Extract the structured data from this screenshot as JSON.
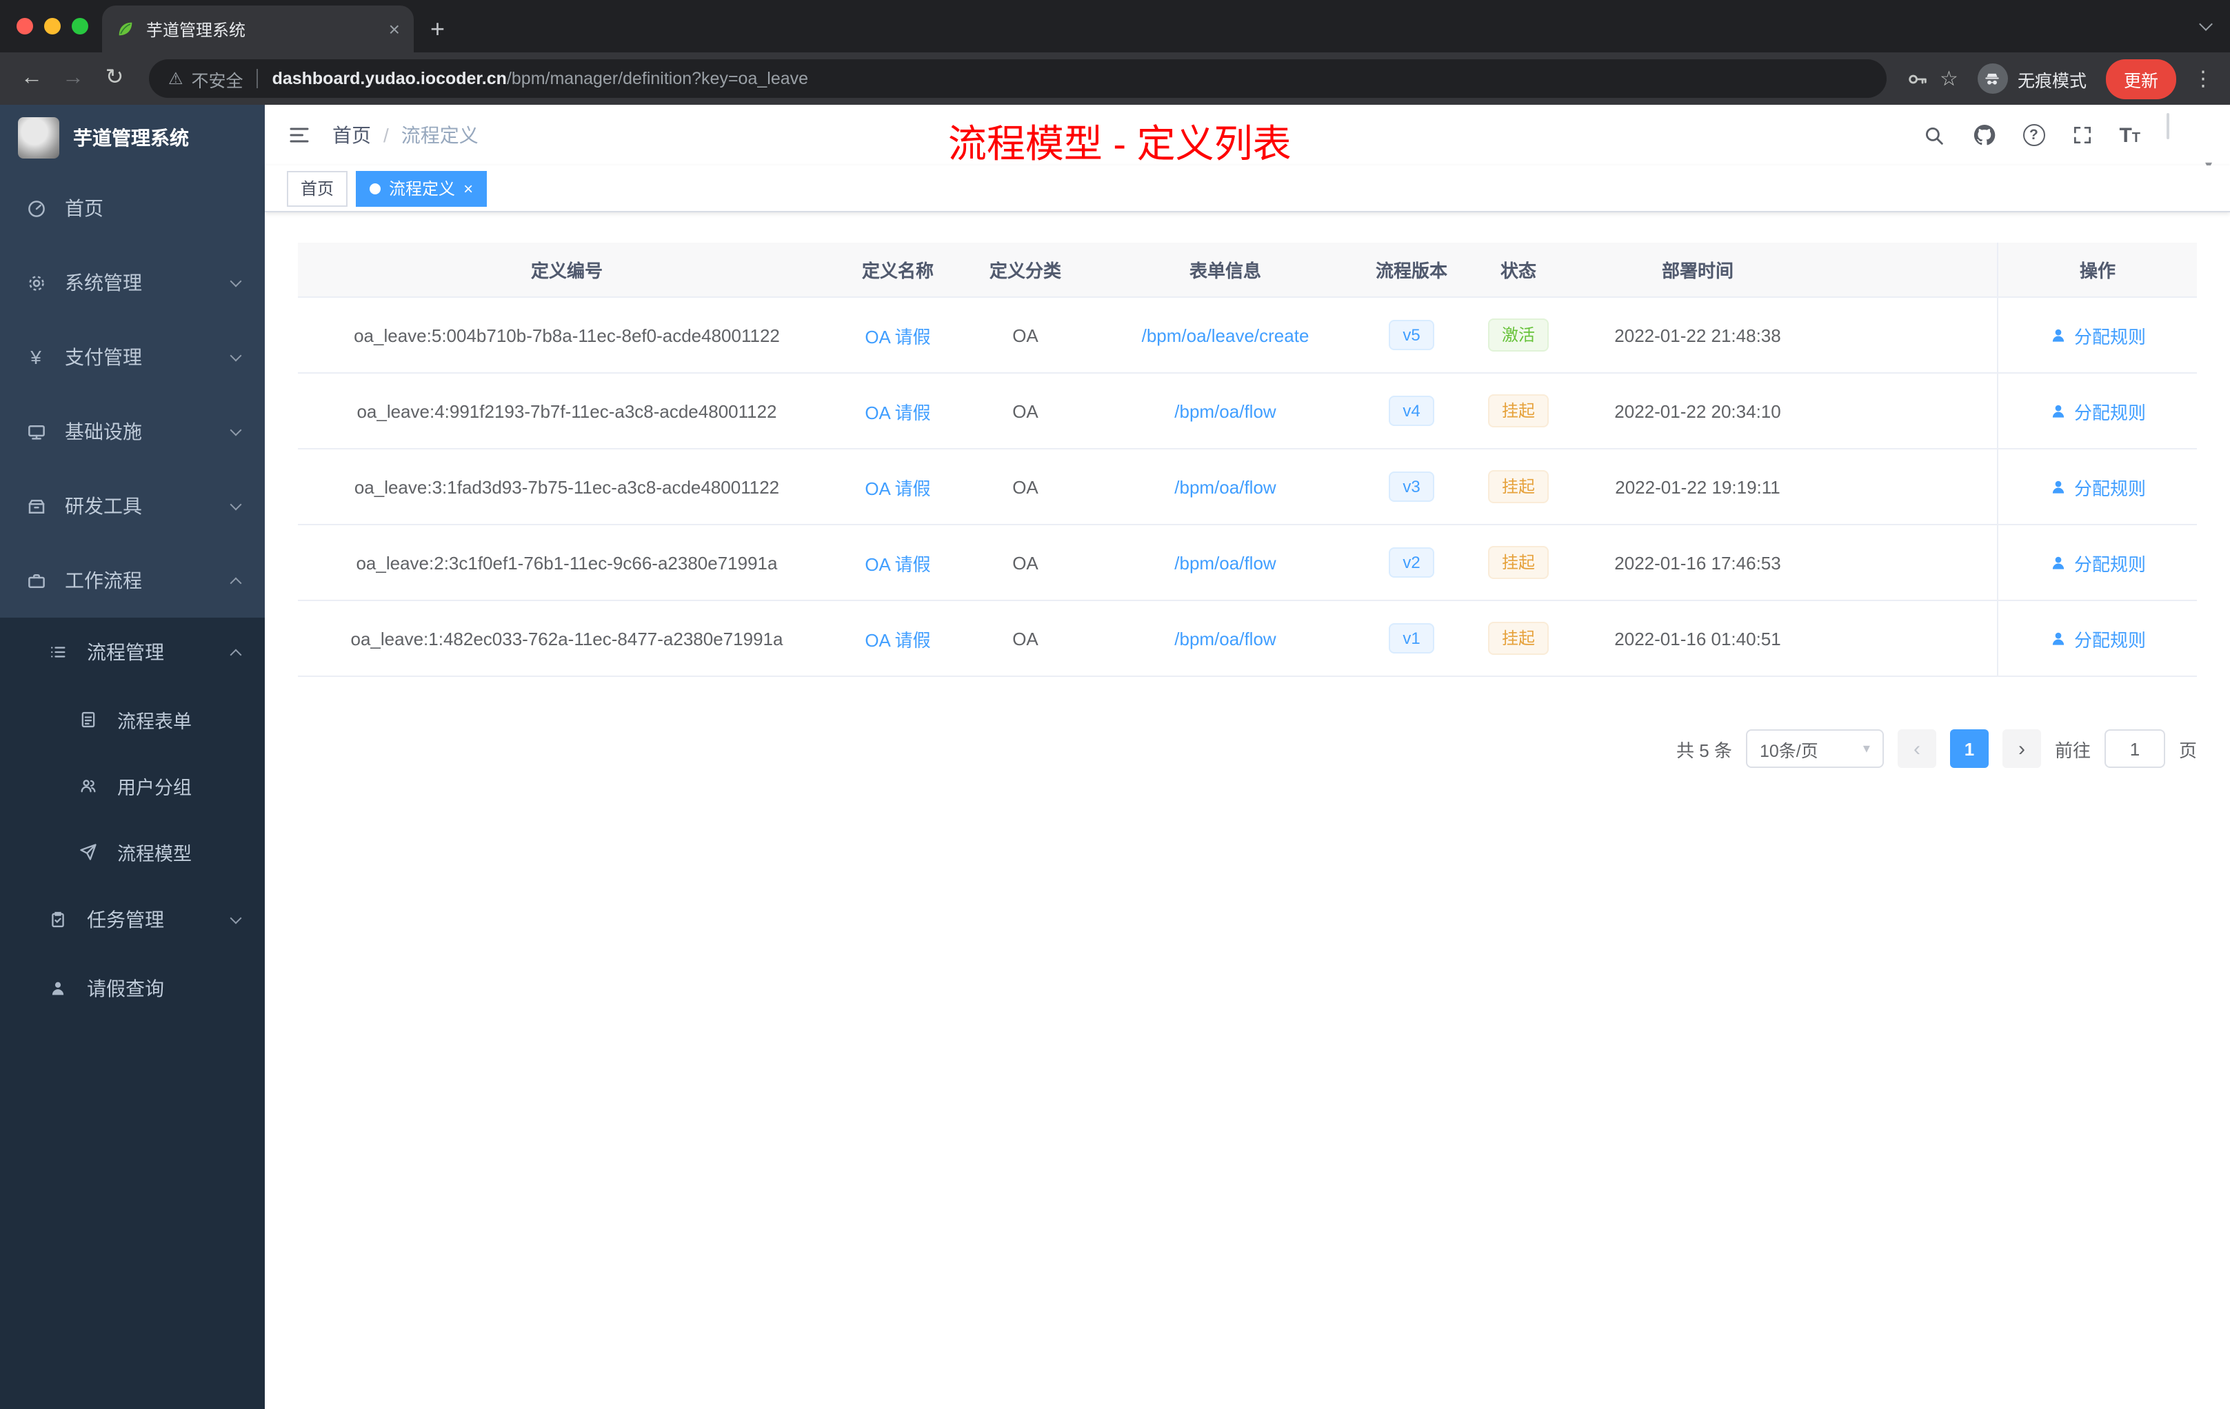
{
  "colors": {
    "accent": "#409eff",
    "success": "#67c23a",
    "warning": "#e6a23c",
    "annotation": "#fe0000",
    "sidebar_bg": "#304156",
    "submenu_bg": "#1f2d3d"
  },
  "icons": {
    "close": "×",
    "new_tab": "+",
    "back": "←",
    "forward": "→",
    "reload": "↻",
    "warning": "⚠",
    "star": "☆",
    "kebab": "⋮",
    "caret_down": "▾",
    "help": "?",
    "yen": "¥",
    "prev": "‹",
    "next": "›",
    "breadcrumb_sep": "/",
    "big_t": "T",
    "small_t": "T"
  },
  "browser": {
    "tab": {
      "title": "芋道管理系统"
    },
    "address": {
      "security": "不安全",
      "domain": "dashboard.yudao.iocoder.cn",
      "path": "/bpm/manager/definition?key=oa_leave"
    },
    "incognito_label": "无痕模式",
    "update_label": "更新"
  },
  "sidebar": {
    "logo_title": "芋道管理系统",
    "items": [
      {
        "label": "首页"
      },
      {
        "label": "系统管理"
      },
      {
        "label": "支付管理"
      },
      {
        "label": "基础设施"
      },
      {
        "label": "研发工具"
      },
      {
        "label": "工作流程"
      },
      {
        "label": "流程管理"
      },
      {
        "label": "流程表单"
      },
      {
        "label": "用户分组"
      },
      {
        "label": "流程模型"
      },
      {
        "label": "任务管理"
      },
      {
        "label": "请假查询"
      }
    ]
  },
  "header": {
    "breadcrumb": {
      "home": "首页",
      "current": "流程定义"
    },
    "annotation": "流程模型 - 定义列表"
  },
  "tags": {
    "home": "首页",
    "active": "流程定义"
  },
  "table": {
    "columns": [
      "定义编号",
      "定义名称",
      "定义分类",
      "表单信息",
      "流程版本",
      "状态",
      "部署时间",
      "操作"
    ],
    "rows": [
      {
        "id": "oa_leave:5:004b710b-7b8a-11ec-8ef0-acde48001122",
        "name": "OA 请假",
        "category": "OA",
        "form": "/bpm/oa/leave/create",
        "version": "v5",
        "status": "激活",
        "status_type": "active",
        "time": "2022-01-22 21:48:38",
        "action": "分配规则"
      },
      {
        "id": "oa_leave:4:991f2193-7b7f-11ec-a3c8-acde48001122",
        "name": "OA 请假",
        "category": "OA",
        "form": "/bpm/oa/flow",
        "version": "v4",
        "status": "挂起",
        "status_type": "suspended",
        "time": "2022-01-22 20:34:10",
        "action": "分配规则"
      },
      {
        "id": "oa_leave:3:1fad3d93-7b75-11ec-a3c8-acde48001122",
        "name": "OA 请假",
        "category": "OA",
        "form": "/bpm/oa/flow",
        "version": "v3",
        "status": "挂起",
        "status_type": "suspended",
        "time": "2022-01-22 19:19:11",
        "action": "分配规则"
      },
      {
        "id": "oa_leave:2:3c1f0ef1-76b1-11ec-9c66-a2380e71991a",
        "name": "OA 请假",
        "category": "OA",
        "form": "/bpm/oa/flow",
        "version": "v2",
        "status": "挂起",
        "status_type": "suspended",
        "time": "2022-01-16 17:46:53",
        "action": "分配规则"
      },
      {
        "id": "oa_leave:1:482ec033-762a-11ec-8477-a2380e71991a",
        "name": "OA 请假",
        "category": "OA",
        "form": "/bpm/oa/flow",
        "version": "v1",
        "status": "挂起",
        "status_type": "suspended",
        "time": "2022-01-16 01:40:51",
        "action": "分配规则"
      }
    ]
  },
  "pagination": {
    "total": "共 5 条",
    "page_size": "10条/页",
    "page": "1",
    "goto_label": "前往",
    "goto_value": "1",
    "goto_unit": "页"
  }
}
